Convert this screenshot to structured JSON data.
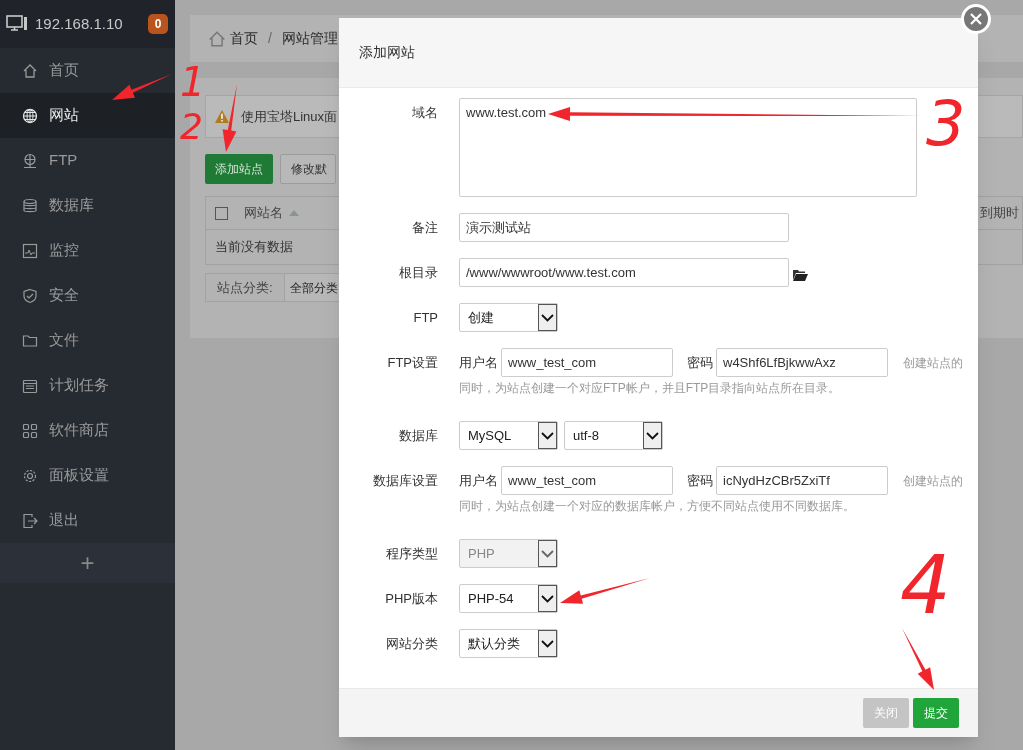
{
  "sidebar": {
    "host": "192.168.1.10",
    "badge": "0",
    "items": [
      {
        "label": "首页",
        "selected": false
      },
      {
        "label": "网站",
        "selected": true
      },
      {
        "label": "FTP",
        "selected": false
      },
      {
        "label": "数据库",
        "selected": false
      },
      {
        "label": "监控",
        "selected": false
      },
      {
        "label": "安全",
        "selected": false
      },
      {
        "label": "文件",
        "selected": false
      },
      {
        "label": "计划任务",
        "selected": false
      },
      {
        "label": "软件商店",
        "selected": false
      },
      {
        "label": "面板设置",
        "selected": false
      },
      {
        "label": "退出",
        "selected": false
      }
    ],
    "add": "+"
  },
  "breadcrumb": [
    "首页",
    "/",
    "网站管理"
  ],
  "page": {
    "notice": "使用宝塔Linux面",
    "buttons": [
      "添加站点",
      "修改默"
    ],
    "table": {
      "select_all_checked": false,
      "columns": [
        "网站名",
        "到期时"
      ],
      "empty": "当前没有数据"
    },
    "category_label": "站点分类:",
    "category_value": "全部分类"
  },
  "dialog": {
    "title": "添加网站",
    "fields": [
      {
        "kind": "textarea",
        "label": "域名",
        "value": "www.test.com"
      },
      {
        "kind": "input",
        "label": "备注",
        "value": "演示测试站"
      },
      {
        "kind": "path",
        "label": "根目录",
        "value": "/www/wwwroot/www.test.com"
      },
      {
        "kind": "select",
        "label": "FTP",
        "selects": [
          {
            "value": "创建",
            "disabled": false
          }
        ]
      },
      {
        "kind": "credentials",
        "label": "FTP设置",
        "user_label": "用户名",
        "user": "www_test_com",
        "password_label": "密码",
        "password": "w4Shf6LfBjkwwAxz",
        "hint": [
          "创建站点的",
          "同时，为站点创建一个对应FTP帐户，并且FTP目录指向站点所在目录。"
        ]
      },
      {
        "kind": "select",
        "label": "数据库",
        "selects": [
          {
            "value": "MySQL",
            "disabled": false
          },
          {
            "value": "utf-8",
            "disabled": false
          }
        ]
      },
      {
        "kind": "credentials",
        "label": "数据库设置",
        "user_label": "用户名",
        "user": "www_test_com",
        "password_label": "密码",
        "password": "icNydHzCBr5ZxiTf",
        "hint": [
          "创建站点的",
          "同时，为站点创建一个对应的数据库帐户，方便不同站点使用不同数据库。"
        ]
      },
      {
        "kind": "select",
        "label": "程序类型",
        "selects": [
          {
            "value": "PHP",
            "disabled": true
          }
        ]
      },
      {
        "kind": "select",
        "label": "PHP版本",
        "selects": [
          {
            "value": "PHP-54",
            "disabled": false
          }
        ]
      },
      {
        "kind": "select",
        "label": "网站分类",
        "selects": [
          {
            "value": "默认分类",
            "disabled": false
          }
        ]
      }
    ],
    "buttons": [
      {
        "label": "关闭",
        "kind": "secondary"
      },
      {
        "label": "提交",
        "kind": "primary"
      }
    ]
  },
  "annotations": [
    {
      "kind": "numbered_arrow",
      "label": "1"
    },
    {
      "kind": "numbered_arrow",
      "label": "2"
    },
    {
      "kind": "numbered_arrow",
      "label": "3"
    },
    {
      "kind": "arrow"
    },
    {
      "kind": "numbered_arrow",
      "label": "4"
    }
  ]
}
